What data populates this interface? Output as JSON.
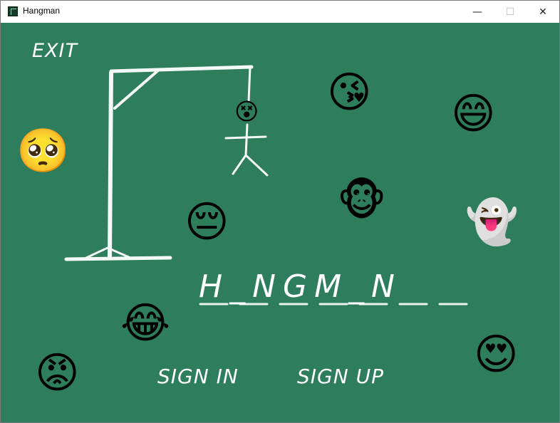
{
  "window": {
    "title": "Hangman",
    "controls": {
      "minimize": "—",
      "maximize": "☐",
      "close": "✕"
    }
  },
  "menu": {
    "exit": "EXIT",
    "sign_in": "SIGN IN",
    "sign_up": "SIGN UP"
  },
  "game": {
    "word_display": "H_NGM_N",
    "hanged_face": "😵"
  },
  "decorations": {
    "emojis": [
      "🥺",
      "😘",
      "😄",
      "🐵",
      "👻",
      "😔",
      "😂",
      "😡",
      "😍"
    ]
  },
  "colors": {
    "board": "#2e7d5c",
    "chalk": "#ffffff"
  }
}
